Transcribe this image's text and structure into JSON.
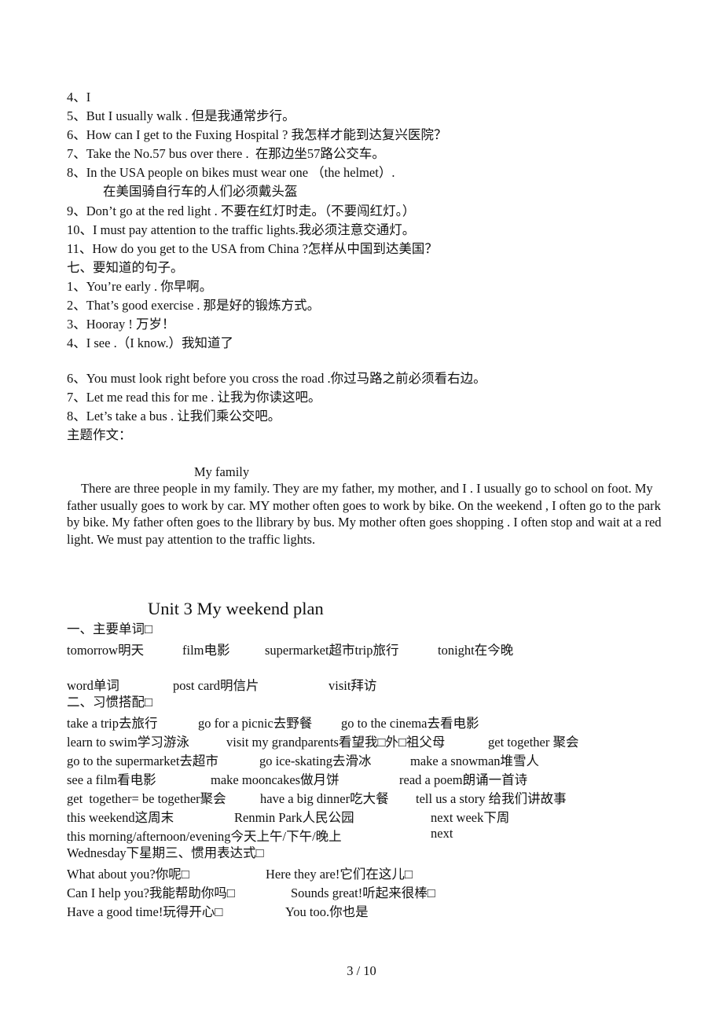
{
  "lines_top": [
    "4、I",
    "5、But I usually walk . 但是我通常步行。",
    "6、How can I get to the Fuxing Hospital ? 我怎样才能到达复兴医院？",
    "7、Take the No.57 bus over there .  在那边坐57路公交车。",
    "8、In the USA people on bikes must wear one （the helmet）.",
    "在美国骑自行车的人们必须戴头盔",
    "9、Don’t go at the red light . 不要在红灯时走。（不要闯红灯。）",
    "10、I must pay attention to the traffic lights.我必须注意交通灯。",
    "11、How do you get to the USA from China ?怎样从中国到达美国？",
    "七、要知道的句子。",
    "1、You’re early . 你早啊。",
    "2、That’s good exercise . 那是好的锻炼方式。",
    "3、Hooray ! 万岁！",
    "4、I see .（I know.）我知道了"
  ],
  "lines_mid": [
    "6、You must look right before you cross the road .你过马路之前必须看右边。",
    "7、Let me read this for me . 让我为你读这吧。",
    "8、Let’s take a bus . 让我们乘公交吧。",
    "主题作文："
  ],
  "essay": {
    "title": "My family",
    "body": "There are three people in my family. They are my father, my mother, and I . I usually go to school on foot. My father usually goes to work by car. MY mother often goes to work by bike.  On the weekend , I often go to the park by bike. My father often goes to the llibrary by bus. My mother often goes shopping . I often stop and wait at a red light. We must pay attention to the traffic lights."
  },
  "unit": {
    "title": "Unit 3 My weekend plan",
    "section1_heading": "一、主要单词□",
    "words_row1": [
      "tomorrow明天",
      "film电影",
      "supermarket超市trip旅行",
      "tonight在今晚"
    ],
    "words_row2": [
      "word单词",
      "post card明信片",
      "visit拜访"
    ],
    "section2_heading": "二、习惯搭配□",
    "phrases": [
      [
        "take a trip去旅行",
        "go for a picnic去野餐",
        "go to the cinema去看电影"
      ],
      [
        "learn to swim学习游泳",
        "visit my grandparents看望我□外□祖父母",
        "get together 聚会"
      ],
      [
        "go to the supermarket去超市",
        "go ice-skating去滑冰",
        "make a snowman堆雪人"
      ],
      [
        "see a film看电影",
        "make mooncakes做月饼",
        "read a poem朗诵一首诗"
      ],
      [
        "get  together= be together聚会",
        "have a big dinner吃大餐",
        "tell us a story 给我们讲故事"
      ],
      [
        "this weekend这周末",
        "Renmin Park人民公园",
        "next week下周"
      ],
      [
        "this morning/afternoon/evening今天上午/下午/晚上",
        "next"
      ]
    ],
    "wednesday_line": "Wednesday下星期三、惯用表达式□",
    "expressions": [
      [
        "What about you?你呢□",
        "Here they are!它们在这儿□"
      ],
      [
        "Can I help you?我能帮助你吗□",
        "Sounds great!听起来很棒□"
      ],
      [
        "Have a good time!玩得开心□",
        "You too.你也是"
      ]
    ]
  },
  "footer": {
    "page": "3 / 10"
  }
}
